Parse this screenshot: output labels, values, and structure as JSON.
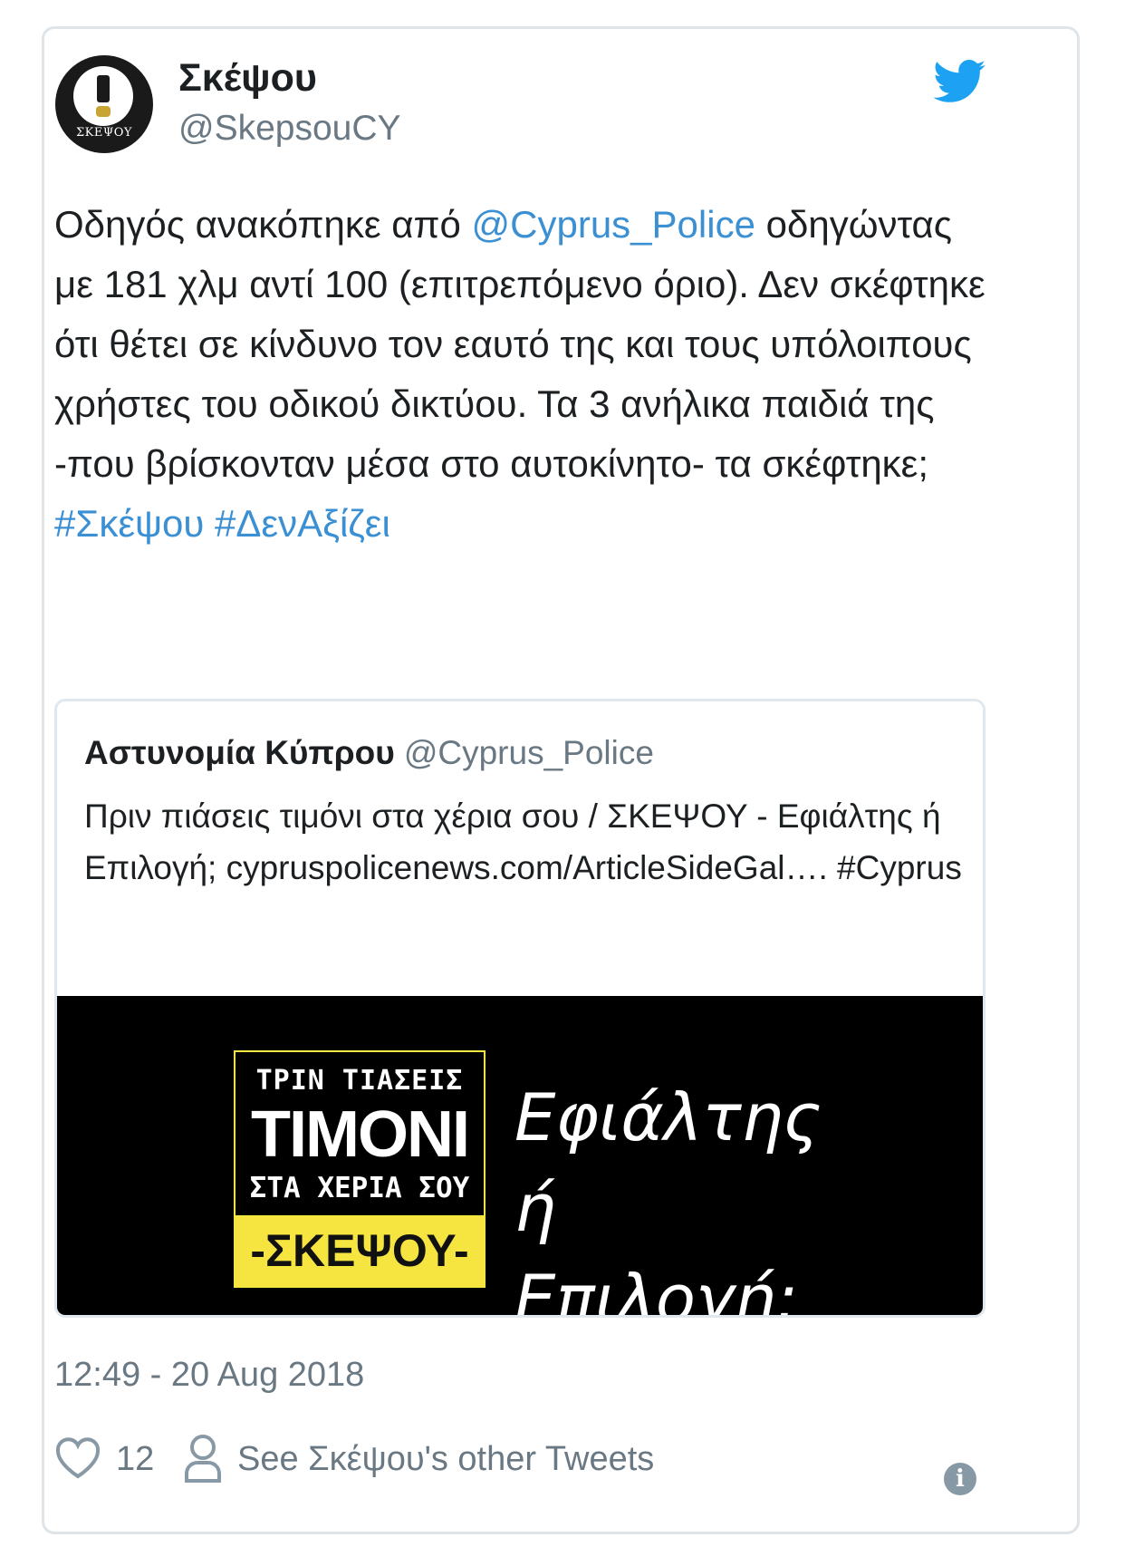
{
  "tweet": {
    "author_name": "Σκέψου",
    "author_handle": "@SkepsouCY",
    "avatar_label": "ΣΚΕΨΟΥ",
    "text_parts": {
      "p1": "Οδηγός ανακόπηκε από ",
      "mention": "@Cyprus_Police",
      "p2": " οδηγώντας με 181 χλμ αντί 100 (επιτρεπόμενο όριο). Δεν σκέφτηκε ότι θέτει σε κίνδυνο τον εαυτό της και τους υπόλοιπους χρήστες του οδικού δικτύου. Τα 3 ανήλικα παιδιά της -που βρίσκονταν μέσα στο αυτοκίνητο- τα σκέφτηκε; ",
      "hashtag1": "#Σκέψου",
      "hashtag2": "#ΔενΑξίζει"
    },
    "timestamp": "12:49 - 20 Aug 2018",
    "likes": "12",
    "other_tweets_label": "See Σκέψου's other Tweets",
    "link_color": "#3b8fd3",
    "brand_icon": "twitter-bird-icon"
  },
  "quote": {
    "author_name": "Αστυνομία Κύπρου",
    "author_handle": "@Cyprus_Police",
    "text": "Πριν πιάσεις τιμόνι στα χέρια σου / ΣΚΕΨΟΥ - Εφιάλτης ή Επιλογή; cypruspolicenews.com/ArticleSideGal…. #Cyprus",
    "image": {
      "logo_line1": "ΤΡΙΝ ΤΙΑΣΕΙΣ",
      "logo_line2": "ΤΙΜΟΝΙ",
      "logo_line3": "ΣΤΑ ΧΕΡΙΑ ΣΟΥ",
      "logo_line4": "-ΣΚΕΨΟΥ-",
      "slogan": "Εφιάλτης ή Επιλογή;",
      "accent_color": "#f6e541"
    }
  }
}
